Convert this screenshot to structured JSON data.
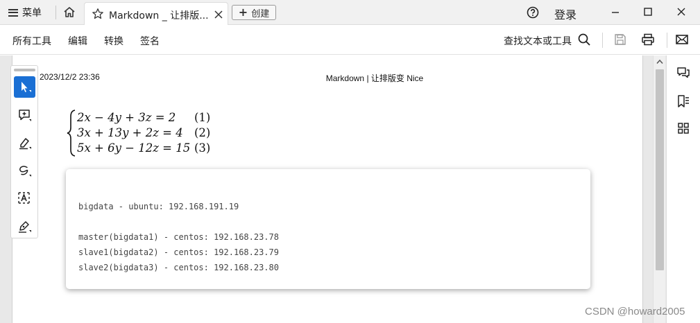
{
  "titlebar": {
    "menu_label": "菜单",
    "tab_title": "Markdown _ 让排版...",
    "new_button_label": "创建",
    "login_label": "登录",
    "icons": [
      "hamburger-icon",
      "home-icon",
      "star-icon",
      "close-icon",
      "plus-icon",
      "help-icon",
      "minimize-icon",
      "maximize-icon",
      "close-window-icon"
    ]
  },
  "toolbar": {
    "menus": [
      "所有工具",
      "编辑",
      "转换",
      "签名"
    ],
    "find_label": "查找文本或工具",
    "icons": [
      "search-icon",
      "save-icon",
      "print-icon",
      "mail-icon"
    ]
  },
  "document": {
    "date": "2023/12/2 23:36",
    "header": "Markdown | 让排版变 Nice",
    "equations": [
      {
        "expr": "2x − 4y + 3z = 2",
        "num": "(1)"
      },
      {
        "expr": "3x + 13y + 2z = 4",
        "num": "(2)"
      },
      {
        "expr": "5x + 6y − 12z = 15",
        "num": "(3)"
      }
    ],
    "code_lines": [
      "bigdata - ubuntu: 192.168.191.19",
      "master(bigdata1) - centos: 192.168.23.78",
      "slave1(bigdata2) - centos: 192.168.23.79",
      "slave2(bigdata3) - centos: 192.168.23.80"
    ]
  },
  "left_tools": [
    "select-tool",
    "add-comment-tool",
    "highlight-tool",
    "draw-tool",
    "text-recognition-tool",
    "sign-tool"
  ],
  "right_tools": [
    "comments-icon",
    "bookmarks-icon",
    "thumbnails-icon"
  ],
  "colors": {
    "accent": "#1a6fd4",
    "titlebar_bg": "#f1f1f1",
    "page_bg": "#ffffff"
  },
  "watermark": "CSDN @howard2005"
}
